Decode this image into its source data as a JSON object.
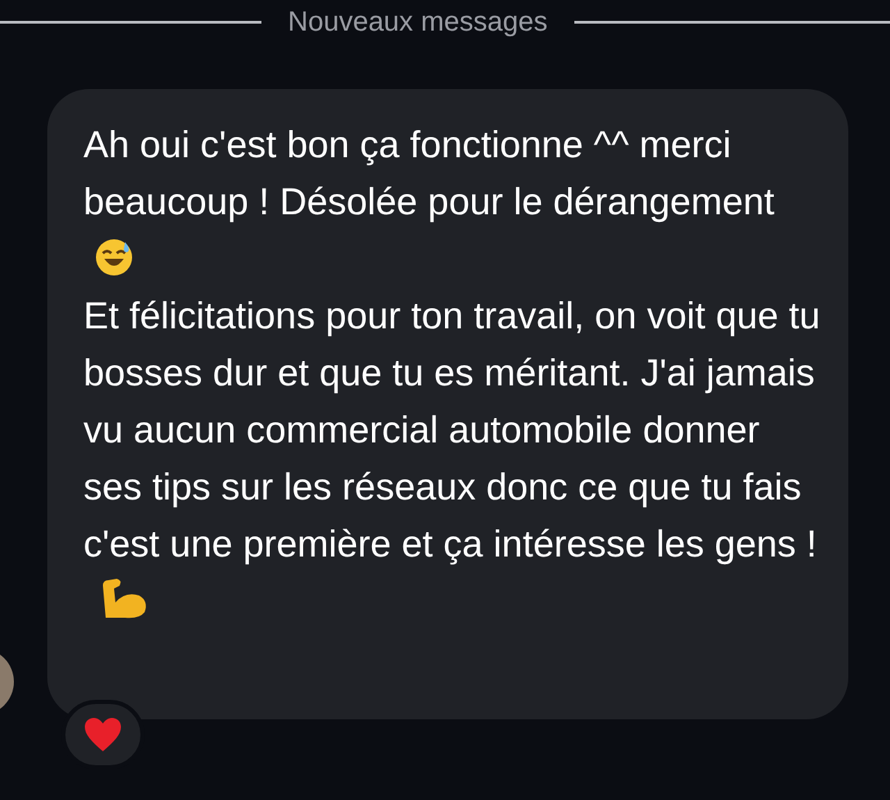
{
  "divider": {
    "label": "Nouveaux messages"
  },
  "message": {
    "paragraphs": [
      {
        "text": "Ah oui c'est bon ça fonctionne ^^ merci beaucoup ! Désolée pour le dérangement"
      },
      {
        "text": "Et félicitations pour ton travail, on voit que tu bosses dur et que tu es méritant. J'ai jamais vu aucun commercial automobile donner ses tips sur les réseaux donc ce que tu fais c'est une première et ça intéresse les gens !"
      }
    ]
  }
}
